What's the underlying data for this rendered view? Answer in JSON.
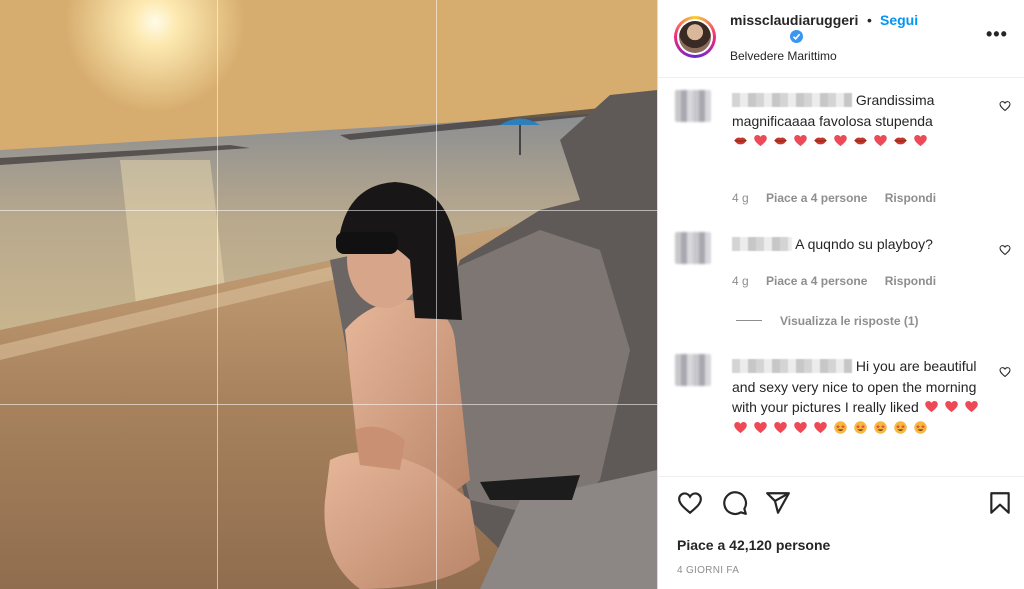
{
  "post": {
    "username": "missclaudiaruggeri",
    "verified": true,
    "separator": "•",
    "follow_label": "Segui",
    "location": "Belvedere Marittimo",
    "more_icon": "more-options-icon",
    "more_label": "•••"
  },
  "comments": [
    {
      "text": "Grandissima magnificaaaa favolosa stupenda",
      "emojis": [
        "lips",
        "heart",
        "lips",
        "heart",
        "lips",
        "heart",
        "lips",
        "heart",
        "lips",
        "heart"
      ],
      "time": "4 g",
      "likes": "Piace a 4 persone",
      "reply": "Rispondi"
    },
    {
      "text": "A quqndo su playboy?",
      "emojis": [],
      "time": "4 g",
      "likes": "Piace a 4 persone",
      "reply": "Rispondi"
    },
    {
      "text": "Hi you are beautiful and sexy very nice to open the morning with your pictures I really liked",
      "emojis": [
        "heart",
        "heart",
        "heart",
        "heart",
        "heart",
        "heart",
        "heart",
        "heart",
        "star-struck",
        "star-struck",
        "star-struck",
        "star-struck",
        "star-struck"
      ],
      "time": "",
      "likes": "",
      "reply": ""
    }
  ],
  "view_replies": "Visualizza le risposte (1)",
  "actions": {
    "like_icon": "heart-outline-icon",
    "comment_icon": "comment-icon",
    "share_icon": "send-icon",
    "save_icon": "bookmark-icon"
  },
  "likes_count": "Piace a 42,120 persone",
  "posted_ago": "4 GIORNI FA",
  "colors": {
    "accent": "#0095f6",
    "verified": "#3897f0",
    "heart": "#ed4956",
    "muted": "#8e8e8e"
  }
}
